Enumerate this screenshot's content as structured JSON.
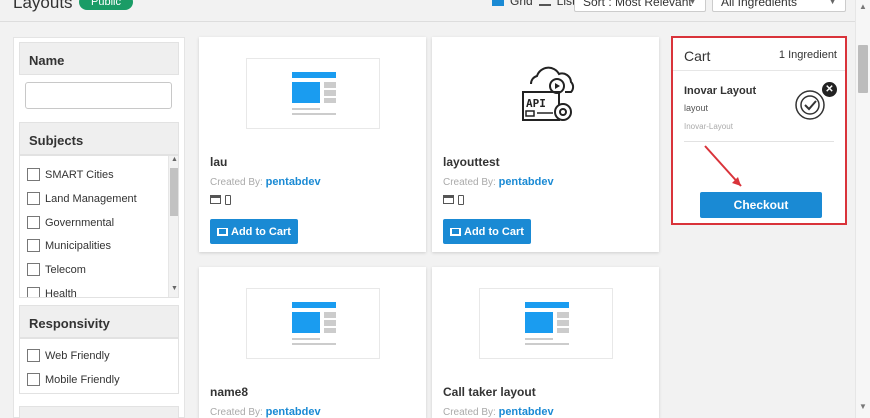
{
  "header": {
    "title": "Layouts",
    "badge": "Public",
    "view_grid": "Grid",
    "view_list": "List",
    "sort": "Sort : Most Relevant",
    "filter": "All Ingredients"
  },
  "filters": {
    "name_label": "Name",
    "subjects_label": "Subjects",
    "subjects": [
      "SMART Cities",
      "Land Management",
      "Governmental",
      "Municipalities",
      "Telecom",
      "Health"
    ],
    "responsivity_label": "Responsivity",
    "responsivity": [
      "Web Friendly",
      "Mobile Friendly"
    ]
  },
  "cards": [
    {
      "title": "lau",
      "created_by_label": "Created By:",
      "author": "pentabdev",
      "button": "Add to Cart"
    },
    {
      "title": "layouttest",
      "created_by_label": "Created By:",
      "author": "pentabdev",
      "button": "Add to Cart"
    },
    {
      "title": "name8",
      "created_by_label": "Created By:",
      "author": "pentabdev"
    },
    {
      "title": "Call taker layout",
      "created_by_label": "Created By:",
      "author": "pentabdev"
    }
  ],
  "cart": {
    "title": "Cart",
    "count": "1 Ingredient",
    "item_name": "Inovar Layout",
    "item_type": "layout",
    "item_org": "Inovar-Layout",
    "checkout": "Checkout"
  },
  "colors": {
    "accent": "#1a8ad4",
    "highlight": "#d9333a",
    "badge": "#1a9c66"
  }
}
